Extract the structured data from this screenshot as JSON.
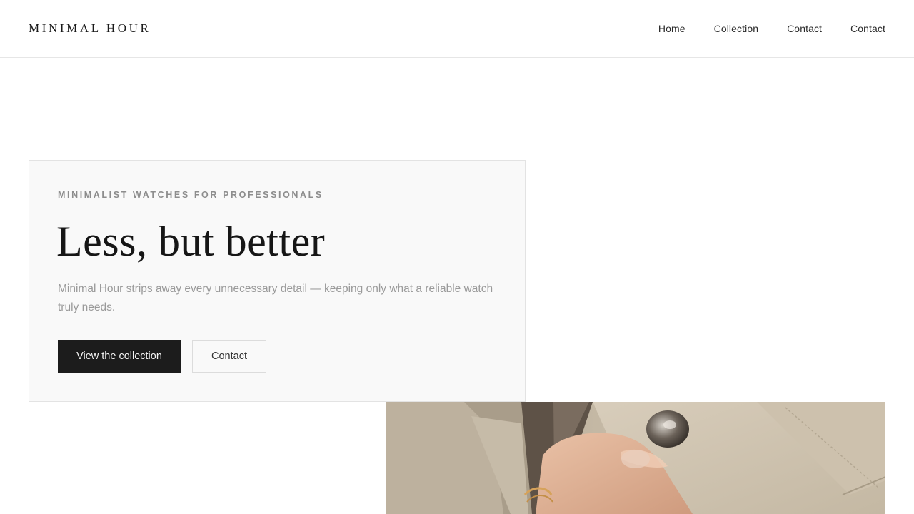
{
  "brand": {
    "logo_text": "MINIMAL HOUR"
  },
  "nav": {
    "items": [
      {
        "label": "Home",
        "active": false
      },
      {
        "label": "Collection",
        "active": false
      },
      {
        "label": "Contact",
        "active": false
      },
      {
        "label": "Contact",
        "active": true
      }
    ]
  },
  "hero": {
    "eyebrow": "MINIMALIST WATCHES FOR PROFESSIONALS",
    "headline": "Less, but better",
    "lede": "Minimal Hour strips away every unnecessary detail — keeping only what a reliable watch truly needs.",
    "primary_button": "View the collection",
    "secondary_button": "Contact"
  },
  "colors": {
    "ink": "#1a1a1a",
    "muted": "#9a9a9a",
    "card_bg": "#f9f9f9",
    "primary_button_bg": "#1c1c1c",
    "coat_beige": "#cfc3b0"
  }
}
